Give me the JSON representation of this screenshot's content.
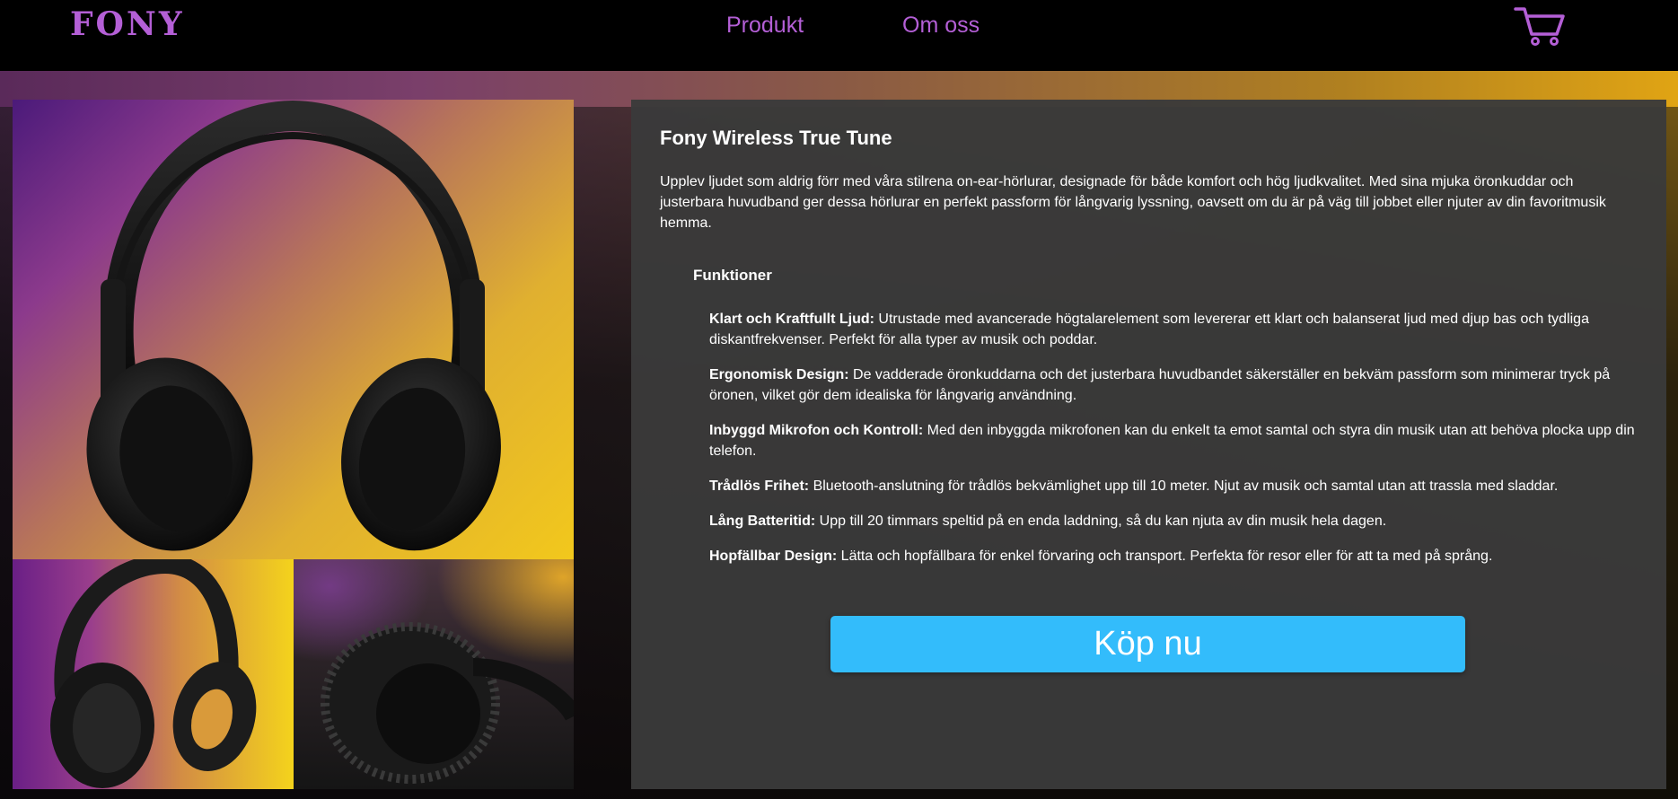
{
  "brand": {
    "logo": "FONY",
    "color": "#b45fd6"
  },
  "nav": {
    "links": [
      {
        "label": "Produkt"
      },
      {
        "label": "Om oss"
      }
    ],
    "cart_icon": "shopping-cart-icon"
  },
  "gallery": {
    "main_image": "headphones-front-view",
    "thumbnails": [
      "headphones-three-quarter-view",
      "headphones-earcup-closeup"
    ]
  },
  "product": {
    "title": "Fony Wireless True Tune",
    "description": "Upplev ljudet som aldrig förr med våra stilrena on-ear-hörlurar, designade för både komfort och hög ljudkvalitet. Med sina mjuka öronkuddar och justerbara huvudband ger dessa hörlurar en perfekt passform för långvarig lyssning, oavsett om du är på väg till jobbet eller njuter av din favoritmusik hemma.",
    "features_heading": "Funktioner",
    "features": [
      {
        "name": "Klart och Kraftfullt Ljud:",
        "text": " Utrustade med avancerade högtalarelement som levererar ett klart och balanserat ljud med djup bas och tydliga diskantfrekvenser. Perfekt för alla typer av musik och poddar."
      },
      {
        "name": "Ergonomisk Design:",
        "text": " De vadderade öronkuddarna och det justerbara huvudbandet säkerställer en bekväm passform som minimerar tryck på öronen, vilket gör dem idealiska för långvarig användning."
      },
      {
        "name": "Inbyggd Mikrofon och Kontroll:",
        "text": " Med den inbyggda mikrofonen kan du enkelt ta emot samtal och styra din musik utan att behöva plocka upp din telefon."
      },
      {
        "name": "Trådlös Frihet:",
        "text": " Bluetooth-anslutning för trådlös bekvämlighet upp till 10 meter. Njut av musik och samtal utan att trassla med sladdar."
      },
      {
        "name": "Lång Batteritid:",
        "text": " Upp till 20 timmars speltid på en enda laddning, så du kan njuta av din musik hela dagen."
      },
      {
        "name": "Hopfällbar Design:",
        "text": " Lätta och hopfällbara för enkel förvaring och transport. Perfekta för resor eller för att ta med på språng."
      }
    ],
    "buy_label": "Köp nu",
    "buy_color": "#33bcfb"
  }
}
